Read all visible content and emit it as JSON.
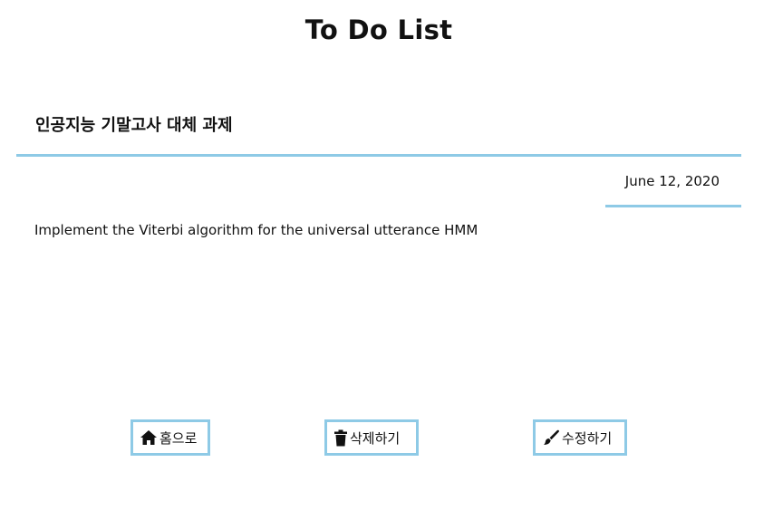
{
  "header": {
    "title": "To Do List"
  },
  "task": {
    "title": "인공지능 기말고사 대체 과제",
    "date": "June 12, 2020",
    "content": "Implement the Viterbi algorithm for the universal utterance HMM"
  },
  "actions": {
    "home_label": "홈으로",
    "delete_label": "삭제하기",
    "edit_label": "수정하기"
  },
  "colors": {
    "accent": "#8ecae6",
    "text": "#111111",
    "background": "#ffffff"
  },
  "icons": {
    "home": "home-icon",
    "delete": "trash-icon",
    "edit": "brush-icon"
  }
}
